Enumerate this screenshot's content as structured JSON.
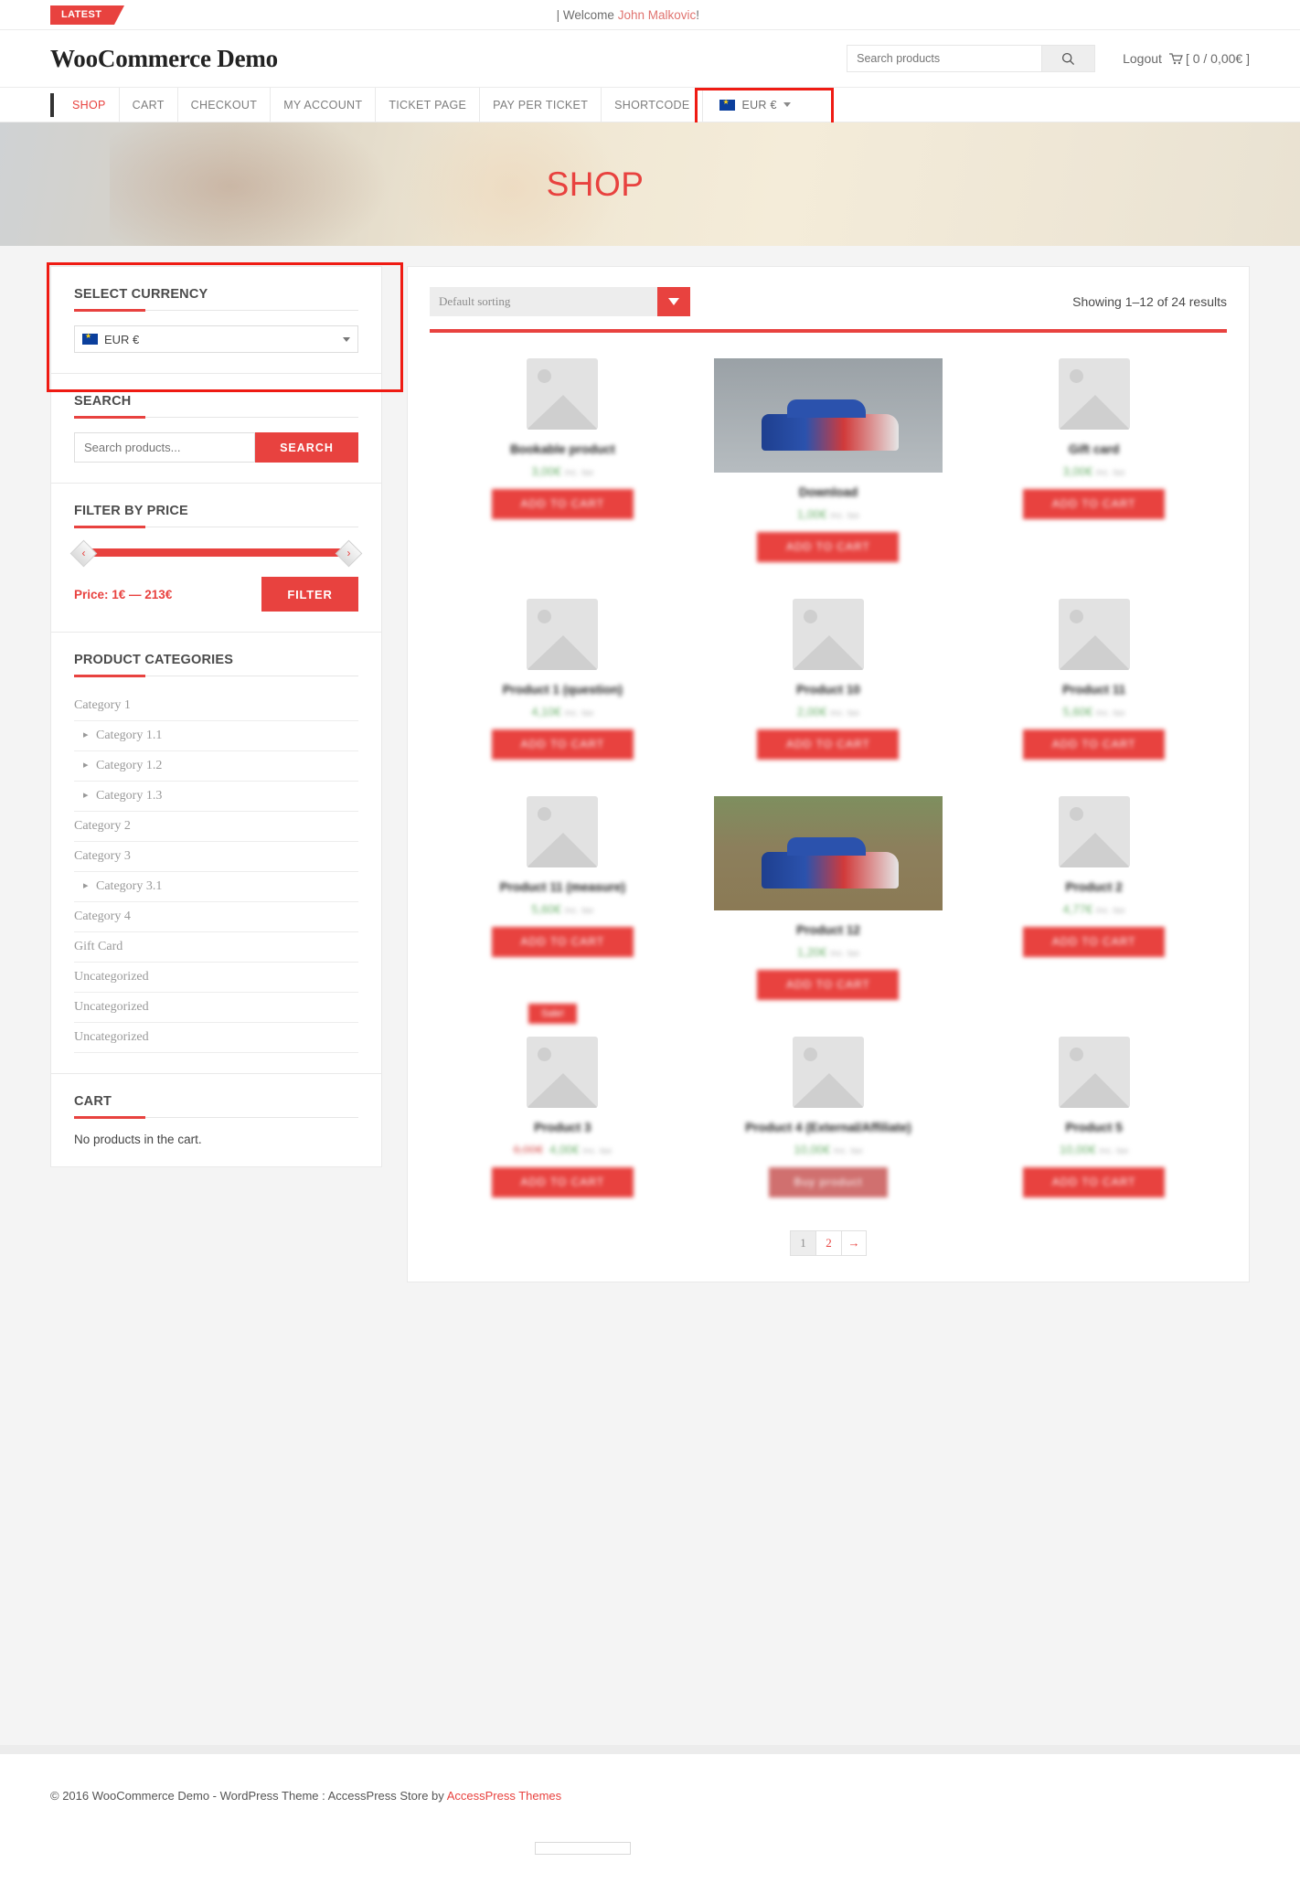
{
  "topbar": {
    "latest_label": "LATEST",
    "welcome_prefix": "| Welcome",
    "welcome_user": "John Malkovic",
    "welcome_suffix": "!"
  },
  "header": {
    "site_title": "WooCommerce Demo",
    "search_placeholder": "Search products",
    "search_icon": "search-icon",
    "logout_label": "Logout",
    "cart_icon": "cart-icon",
    "cart_summary": "[ 0 / 0,00€ ]"
  },
  "nav": {
    "items": [
      {
        "label": "SHOP",
        "active": true
      },
      {
        "label": "CART",
        "active": false
      },
      {
        "label": "CHECKOUT",
        "active": false
      },
      {
        "label": "MY ACCOUNT",
        "active": false
      },
      {
        "label": "TICKET PAGE",
        "active": false
      },
      {
        "label": "PAY PER TICKET",
        "active": false
      },
      {
        "label": "SHORTCODE",
        "active": false
      }
    ],
    "currency_label": "EUR €",
    "currency_flag_icon": "eu-flag-icon",
    "currency_caret_icon": "chevron-down-icon"
  },
  "hero": {
    "title": "SHOP"
  },
  "sidebar": {
    "currency_widget": {
      "title": "SELECT CURRENCY",
      "selected": "EUR €",
      "flag_icon": "eu-flag-icon"
    },
    "search_widget": {
      "title": "SEARCH",
      "placeholder": "Search products...",
      "button_label": "SEARCH"
    },
    "price_widget": {
      "title": "FILTER BY PRICE",
      "price_label": "Price: 1€ — 213€",
      "min": 1,
      "max": 213,
      "button_label": "FILTER",
      "handle_left_icon": "chevron-left-icon",
      "handle_right_icon": "chevron-right-icon"
    },
    "categories_widget": {
      "title": "PRODUCT CATEGORIES",
      "items": [
        {
          "label": "Category 1",
          "child": false
        },
        {
          "label": "Category 1.1",
          "child": true
        },
        {
          "label": "Category 1.2",
          "child": true
        },
        {
          "label": "Category 1.3",
          "child": true
        },
        {
          "label": "Category 2",
          "child": false
        },
        {
          "label": "Category 3",
          "child": false
        },
        {
          "label": "Category 3.1",
          "child": true
        },
        {
          "label": "Category 4",
          "child": false
        },
        {
          "label": "Gift Card",
          "child": false
        },
        {
          "label": "Uncategorized",
          "child": false
        },
        {
          "label": "Uncategorized",
          "child": false
        },
        {
          "label": "Uncategorized",
          "child": false
        }
      ]
    },
    "cart_widget": {
      "title": "CART",
      "empty_text": "No products in the cart."
    }
  },
  "shop": {
    "sorting_selected": "Default sorting",
    "sorting_caret_icon": "caret-down-icon",
    "result_count": "Showing 1–12 of 24 results",
    "products": [
      {
        "name": "Bookable product",
        "price": "3,00€",
        "tax": "inc. tax",
        "old_price": "",
        "button": "ADD TO CART",
        "image": "placeholder",
        "sale": false
      },
      {
        "name": "Download",
        "price": "1,00€",
        "tax": "inc. tax",
        "old_price": "",
        "button": "ADD TO CART",
        "image": "car",
        "sale": false
      },
      {
        "name": "Gift card",
        "price": "3,00€",
        "tax": "inc. tax",
        "old_price": "",
        "button": "ADD TO CART",
        "image": "placeholder",
        "sale": false
      },
      {
        "name": "Product 1 (question)",
        "price": "4,10€",
        "tax": "inc. tax",
        "old_price": "",
        "button": "ADD TO CART",
        "image": "placeholder",
        "sale": false
      },
      {
        "name": "Product 10",
        "price": "2,00€",
        "tax": "inc. tax",
        "old_price": "",
        "button": "ADD TO CART",
        "image": "placeholder",
        "sale": false
      },
      {
        "name": "Product 11",
        "price": "5,60€",
        "tax": "inc. tax",
        "old_price": "",
        "button": "ADD TO CART",
        "image": "placeholder",
        "sale": false
      },
      {
        "name": "Product 11 (measure)",
        "price": "5,60€",
        "tax": "inc. tax",
        "old_price": "",
        "button": "ADD TO CART",
        "image": "placeholder",
        "sale": false
      },
      {
        "name": "Product 12",
        "price": "1,20€",
        "tax": "inc. tax",
        "old_price": "",
        "button": "ADD TO CART",
        "image": "car2",
        "sale": false
      },
      {
        "name": "Product 2",
        "price": "4,77€",
        "tax": "inc. tax",
        "old_price": "",
        "button": "ADD TO CART",
        "image": "placeholder",
        "sale": false
      },
      {
        "name": "Product 3",
        "price": "4,00€",
        "tax": "inc. tax",
        "old_price": "6,00€",
        "button": "ADD TO CART",
        "image": "placeholder",
        "sale": true
      },
      {
        "name": "Product 4 (External/Affiliate)",
        "price": "10,00€",
        "tax": "inc. tax",
        "old_price": "",
        "button": "Buy product",
        "image": "placeholder",
        "sale": false
      },
      {
        "name": "Product 5",
        "price": "10,00€",
        "tax": "inc. tax",
        "old_price": "",
        "button": "ADD TO CART",
        "image": "placeholder",
        "sale": false
      }
    ],
    "sale_badge": "Sale!",
    "pagination": [
      {
        "label": "1",
        "current": true
      },
      {
        "label": "2",
        "current": false
      },
      {
        "label": "→",
        "current": false
      }
    ]
  },
  "footer": {
    "text": "© 2016 WooCommerce Demo - WordPress Theme : AccessPress Store by ",
    "link": "AccessPress Themes"
  },
  "colors": {
    "accent": "#e8423f",
    "highlight_box": "#ef1b13",
    "price_green": "#6bb06b"
  }
}
